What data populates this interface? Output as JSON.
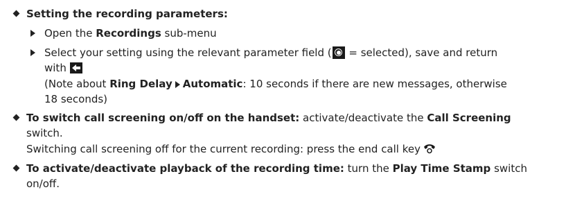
{
  "sections": {
    "recording_params": {
      "heading": "Setting the recording parameters:",
      "step1": {
        "prefix": "Open the ",
        "bold": "Recordings",
        "suffix": " sub-menu"
      },
      "step2": {
        "text_a": "Select your setting using the relevant parameter field (",
        "text_b": " = selected), save and return",
        "text_c": "with "
      },
      "note": {
        "open": "(Note about ",
        "bold1": "Ring Delay",
        "bold2": "Automatic",
        "rest": ": 10 seconds if there are new messages, otherwise",
        "line2": "18 seconds)"
      }
    },
    "call_screening": {
      "heading": "To switch call screening on/off on the handset:",
      "text_a": " activate/deactivate the ",
      "bold": "Call Screening",
      "line2": "switch.",
      "line3": "Switching call screening off for the current recording: press the end call key"
    },
    "playback": {
      "heading": "To activate/deactivate playback of the recording time:",
      "text_a": " turn the ",
      "bold": "Play Time Stamp",
      "text_b": " switch",
      "line2": "on/off."
    }
  },
  "icons": {
    "selected_radio": "radio-selected-icon",
    "back": "back-arrow-icon",
    "end_call": "end-call-icon",
    "bullet": "diamond-bullet-icon",
    "step": "triangle-step-icon"
  }
}
